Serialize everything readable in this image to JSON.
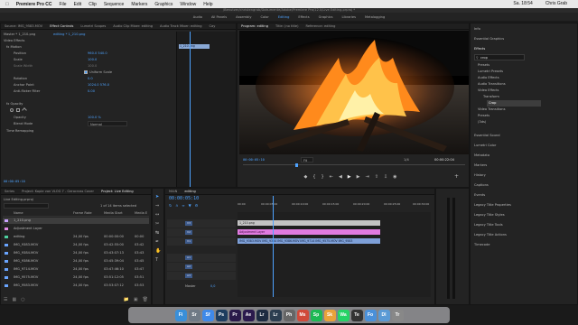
{
  "menubar": {
    "apple": "",
    "app": "Premiere Pro CC",
    "items": [
      "File",
      "Edit",
      "Clip",
      "Sequence",
      "Markers",
      "Graphics",
      "Window",
      "Help"
    ],
    "clock": "Sa. 18:54",
    "user": "Chris Grab"
  },
  "titlebar": "/Benutzer/christengrab/Dokumente/Adobe/Premiere Pro/12.0/Live Editing.prproj *",
  "workspaces": [
    "Audio",
    "All Panels",
    "Assembly",
    "Color",
    "Editing",
    "Effects",
    "Graphics",
    "Libraries",
    "Metalogging"
  ],
  "workspace_active": "Editing",
  "effect_controls": {
    "tabs": [
      "Source: IMG_9583.MOV",
      "Effect Controls",
      "Lumetri Scopes",
      "Audio Clip Mixer: editing",
      "Audio Track Mixer: editing",
      "Cay"
    ],
    "clip_path": "Master * 1_210.png",
    "clip_sel": "editing * 1_210.png",
    "mini_clip": "1_210.png",
    "video_effects": "Video Effects",
    "motion": "fx Motion",
    "position_label": "Position",
    "position_value": "960.0    540.0",
    "scale_label": "Scale",
    "scale_value": "100.0",
    "scale_width_label": "Scale Width",
    "scale_width_value": "100.0",
    "uniform_scale": "Uniform Scale",
    "rotation_label": "Rotation",
    "rotation_value": "0.0",
    "anchor_label": "Anchor Point",
    "anchor_value": "1024.0    576.0",
    "antiflicker_label": "Anti-flicker Filter",
    "antiflicker_value": "0.00",
    "opacity_section": "fx Opacity",
    "opacity_label": "Opacity",
    "opacity_value": "100.0 %",
    "blend_label": "Blend Mode",
    "blend_value": "Normal",
    "time_remap": "Time Remapping",
    "timecode": "00:00:05:10"
  },
  "program": {
    "tabs": [
      "Program: editing",
      "Title: (no title)",
      "Reference: editing"
    ],
    "timecode_left": "00:00:05:10",
    "fit": "Fit",
    "quality": "1/4",
    "timecode_right": "00:00:22:04"
  },
  "project": {
    "tabs": [
      "Series",
      "Project: Kopie von VLOG 7 - Gerocross Cover",
      "Project: Live Editing"
    ],
    "file": "Live Editing.prproj",
    "selection_info": "1 of 14 items selected",
    "columns": [
      "Name",
      "Frame Rate",
      "Media Start",
      "Media E"
    ],
    "rows": [
      {
        "name": "1_210.png",
        "rate": "",
        "start": "",
        "end": "",
        "color": "#c9a2ff"
      },
      {
        "name": "Adjustment Layer",
        "rate": "",
        "start": "",
        "end": "",
        "color": "#e28ce6"
      },
      {
        "name": "editing",
        "rate": "24,00 fps",
        "start": "00:00:00:00",
        "end": "00:00",
        "color": "#4dd0a0"
      },
      {
        "name": "IMG_9383.MOV",
        "rate": "24,00 fps",
        "start": "03:42:55:00",
        "end": "03:42",
        "color": "#6aa5ff"
      },
      {
        "name": "IMG_9384.MOV",
        "rate": "24,00 fps",
        "start": "03:43:07:13",
        "end": "03:43",
        "color": "#6aa5ff"
      },
      {
        "name": "IMG_9386.MOV",
        "rate": "24,00 fps",
        "start": "03:45:39:04",
        "end": "03:45",
        "color": "#6aa5ff"
      },
      {
        "name": "IMG_9714.MOV",
        "rate": "24,00 fps",
        "start": "03:47:46:10",
        "end": "03:47",
        "color": "#6aa5ff"
      },
      {
        "name": "IMG_9575.MOV",
        "rate": "24,00 fps",
        "start": "03:51:12:05",
        "end": "03:51",
        "color": "#6aa5ff"
      },
      {
        "name": "IMG_9583.MOV",
        "rate": "24,00 fps",
        "start": "03:53:07:12",
        "end": "03:53",
        "color": "#6aa5ff"
      }
    ]
  },
  "timeline": {
    "tabs": [
      "MAIN",
      "editing"
    ],
    "timecode": "00:00:05:10",
    "ruler": [
      "00:00",
      "00:00:05:00",
      "00:00:10:00",
      "00:00:15:00",
      "00:00:20:00",
      "00:00:25:00",
      "00:00:30:00"
    ],
    "tracks_v": [
      "V3",
      "V2",
      "V1"
    ],
    "tracks_a": [
      "A1",
      "A2",
      "A3"
    ],
    "master_label": "Master",
    "master_value": "0,0",
    "clip_v3": "1_210.png",
    "clip_v2": "Adjustment Layer",
    "clip_v1": "IMG_9383.MOV  IMG_9384  IMG_9386.MOV  IMG_9714  IMG_9575.MOV  IMG_9583",
    "playhead_fraction": 0.18
  },
  "effects_panel": {
    "tabs": [
      "Info",
      "Essential Graphics",
      "Effects"
    ],
    "search_value": "crop",
    "tree": [
      "Presets",
      "Lumetri Presets",
      "Audio Effects",
      "Audio Transitions",
      "Video Effects",
      "Transform",
      "Crop",
      "Video Transitions",
      "Presets",
      "(3ds)"
    ],
    "sections": [
      "Essential Sound",
      "Lumetri Color",
      "Metadata",
      "Markers",
      "History",
      "Captions",
      "Events",
      "Legacy Title Properties",
      "Legacy Title Styles",
      "Legacy Title Tools",
      "Legacy Title Actions",
      "Timecode"
    ]
  },
  "dock": {
    "icons": [
      "Fi",
      "Sr",
      "Sf",
      "Ps",
      "Pr",
      "Ae",
      "Lr",
      "Lr",
      "Ph",
      "Ms",
      "Sp",
      "Sk",
      "Wa",
      "Te",
      "Fo",
      "Dl",
      "Tr"
    ],
    "colors": [
      "#3a8fd8",
      "#6f7a86",
      "#3f89e8",
      "#1d3d5f",
      "#2a1a4a",
      "#2b1a4d",
      "#1d2b41",
      "#2c3e50",
      "#666",
      "#d04a3a",
      "#1db954",
      "#e8a33a",
      "#25d366",
      "#333",
      "#4a90d9",
      "#5a9ad5",
      "#888"
    ]
  }
}
